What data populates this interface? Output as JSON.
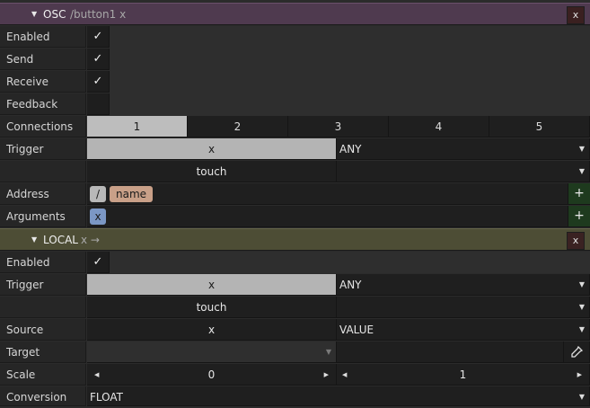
{
  "osc": {
    "header": {
      "title": "OSC",
      "subtitle": "/button1 x",
      "close_label": "x"
    },
    "enabled": {
      "label": "Enabled",
      "check": "✓"
    },
    "send": {
      "label": "Send",
      "check": "✓"
    },
    "receive": {
      "label": "Receive",
      "check": "✓"
    },
    "feedback": {
      "label": "Feedback"
    },
    "connections": {
      "label": "Connections",
      "tabs": [
        "1",
        "2",
        "3",
        "4",
        "5"
      ],
      "active_tab": "1"
    },
    "trigger": {
      "label": "Trigger",
      "value": "x",
      "mode": "ANY",
      "event": "touch"
    },
    "address": {
      "label": "Address",
      "tokens": [
        "/",
        "name"
      ],
      "add_label": "+"
    },
    "arguments": {
      "label": "Arguments",
      "tokens": [
        "x"
      ],
      "add_label": "+"
    }
  },
  "local": {
    "header": {
      "title": "LOCAL",
      "subtitle": "x →",
      "close_label": "x"
    },
    "enabled": {
      "label": "Enabled",
      "check": "✓"
    },
    "trigger": {
      "label": "Trigger",
      "value": "x",
      "mode": "ANY",
      "event": "touch"
    },
    "source": {
      "label": "Source",
      "value": "x",
      "mode": "VALUE"
    },
    "target": {
      "label": "Target"
    },
    "scale": {
      "label": "Scale",
      "min": "0",
      "max": "1"
    },
    "conversion": {
      "label": "Conversion",
      "value": "FLOAT"
    }
  },
  "icons": {
    "collapse": "triangle-down-icon",
    "dropdown": "chevron-down-icon",
    "picker": "eyedropper-icon",
    "left": "arrow-left-icon",
    "right": "arrow-right-icon"
  },
  "colors": {
    "osc_header": "#4f3a4f",
    "local_header": "#4d4d35",
    "selected": "#b4b4b4",
    "token_slash": "#b8b8b8",
    "token_name": "#c9a088",
    "token_arg": "#7b97c4"
  }
}
